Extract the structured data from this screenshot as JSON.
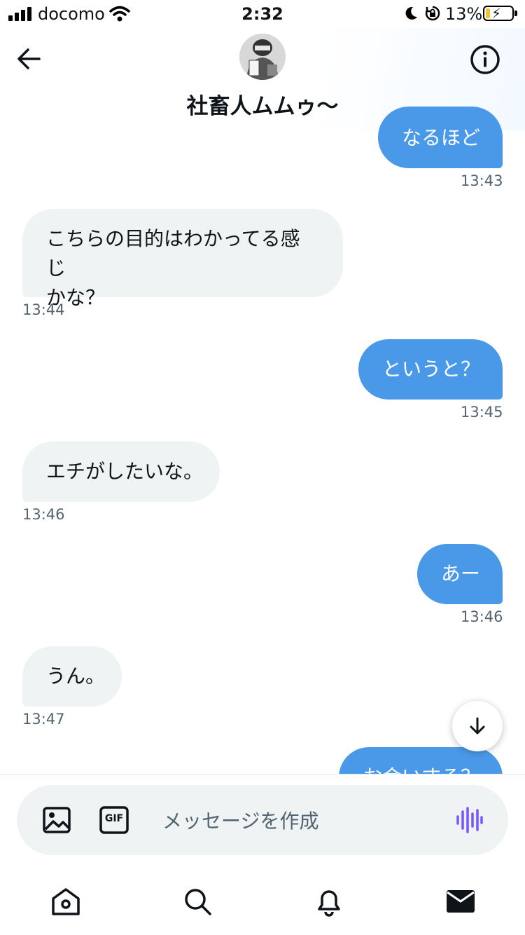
{
  "status_bar": {
    "carrier": "docomo",
    "time": "2:32",
    "battery_percent": "13%",
    "battery_level": 0.13,
    "icons": [
      "signal-icon",
      "wifi-icon",
      "moon-icon",
      "rotation-lock-icon",
      "battery-charging-icon"
    ]
  },
  "header": {
    "contact_name": "社畜人ムムゥ〜",
    "back_icon": "arrow-left-icon",
    "info_icon": "info-icon"
  },
  "messages": [
    {
      "direction": "out",
      "text": "なるほど",
      "time": "13:43"
    },
    {
      "direction": "in",
      "lines": [
        "こちらの目的はわかってる感じ",
        "かな？"
      ],
      "time": "13:44"
    },
    {
      "direction": "out",
      "text": "というと？",
      "time": "13:45"
    },
    {
      "direction": "in",
      "text": "エチがしたいな。",
      "time": "13:46"
    },
    {
      "direction": "out",
      "text": "あー",
      "time": "13:46"
    },
    {
      "direction": "in",
      "text": "うん。",
      "time": "13:47"
    },
    {
      "direction": "out",
      "text": "お会いする？"
    }
  ],
  "composer": {
    "placeholder": "メッセージを作成",
    "gif_label": "GIF"
  },
  "colors": {
    "accent": "#4a99e9",
    "incoming_bubble": "#eff3f4",
    "secondary_text": "#536471",
    "voice_accent": "#7856ff"
  },
  "nav": [
    "home-icon",
    "search-icon",
    "bell-icon",
    "mail-icon"
  ]
}
